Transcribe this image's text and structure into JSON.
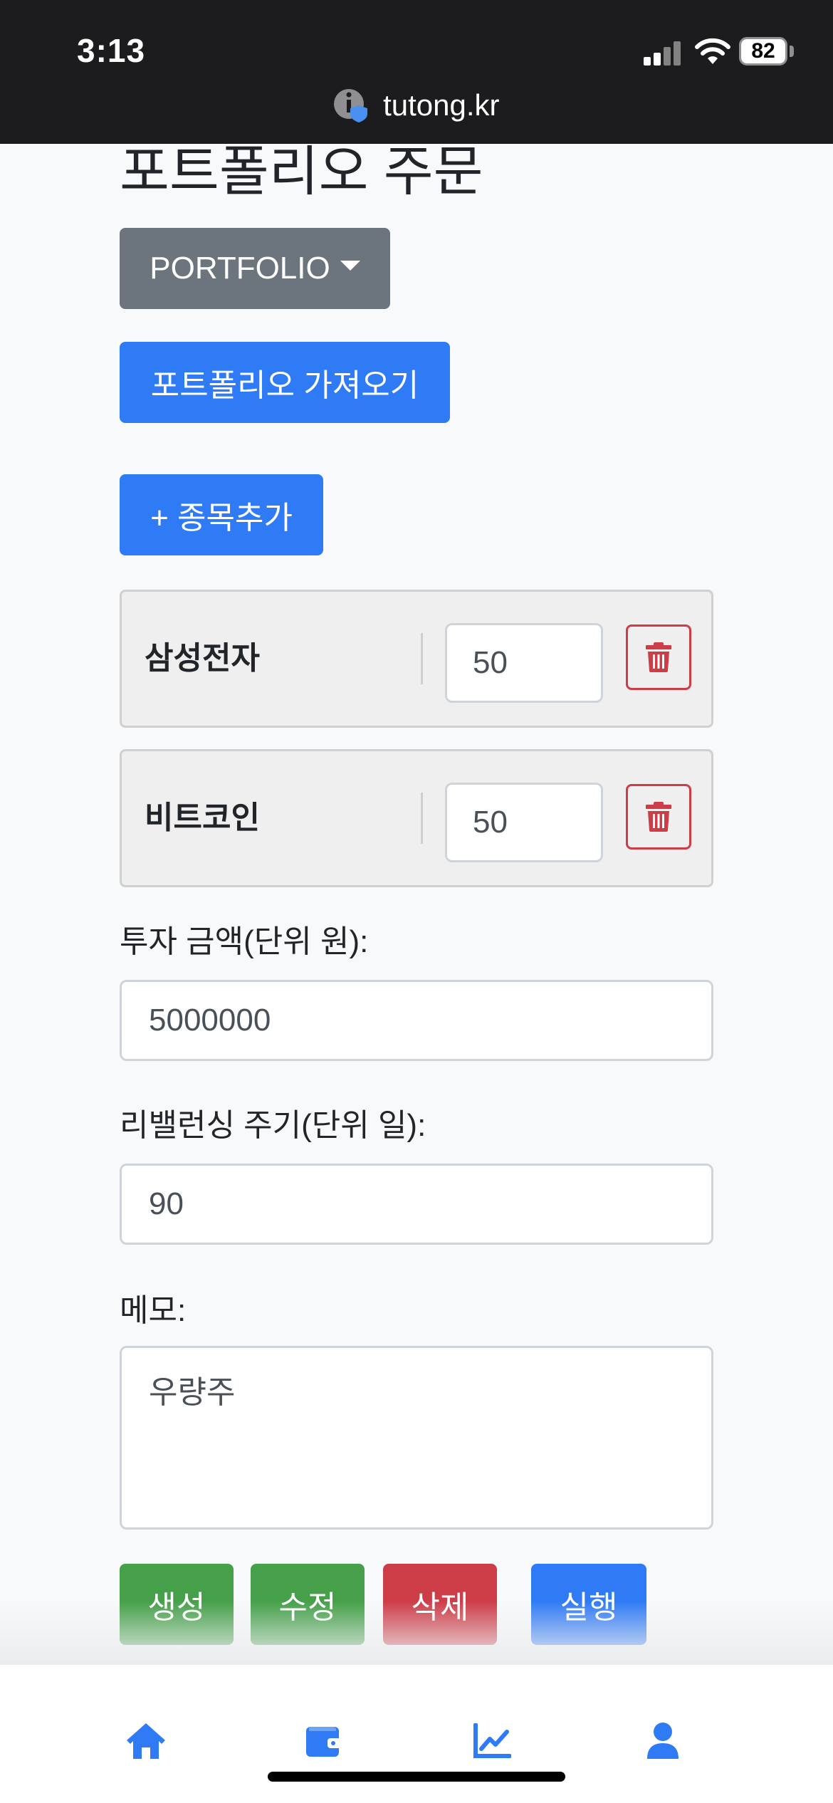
{
  "status_bar": {
    "time": "3:13",
    "battery": "82",
    "url": "tutong.kr"
  },
  "page": {
    "title": "포트폴리오 주문",
    "dropdown_label": "PORTFOLIO",
    "import_button": "포트폴리오 가져오기",
    "add_stock_button": "+ 종목추가"
  },
  "stocks": [
    {
      "name": "삼성전자",
      "weight": "50"
    },
    {
      "name": "비트코인",
      "weight": "50"
    }
  ],
  "form": {
    "amount_label": "투자 금액(단위 원):",
    "amount_value": "5000000",
    "period_label": "리밸런싱 주기(단위 일):",
    "period_value": "90",
    "memo_label": "메모:",
    "memo_value": "우량주"
  },
  "actions": {
    "create": "생성",
    "edit": "수정",
    "delete": "삭제",
    "execute": "실행"
  },
  "bottom_nav": [
    {
      "icon": "home-icon"
    },
    {
      "icon": "wallet-icon"
    },
    {
      "icon": "chart-line-icon"
    },
    {
      "icon": "user-icon"
    }
  ],
  "colors": {
    "primary": "#2f7bf5",
    "secondary": "#6c757d",
    "success": "#45a049",
    "danger": "#cc3d48"
  }
}
